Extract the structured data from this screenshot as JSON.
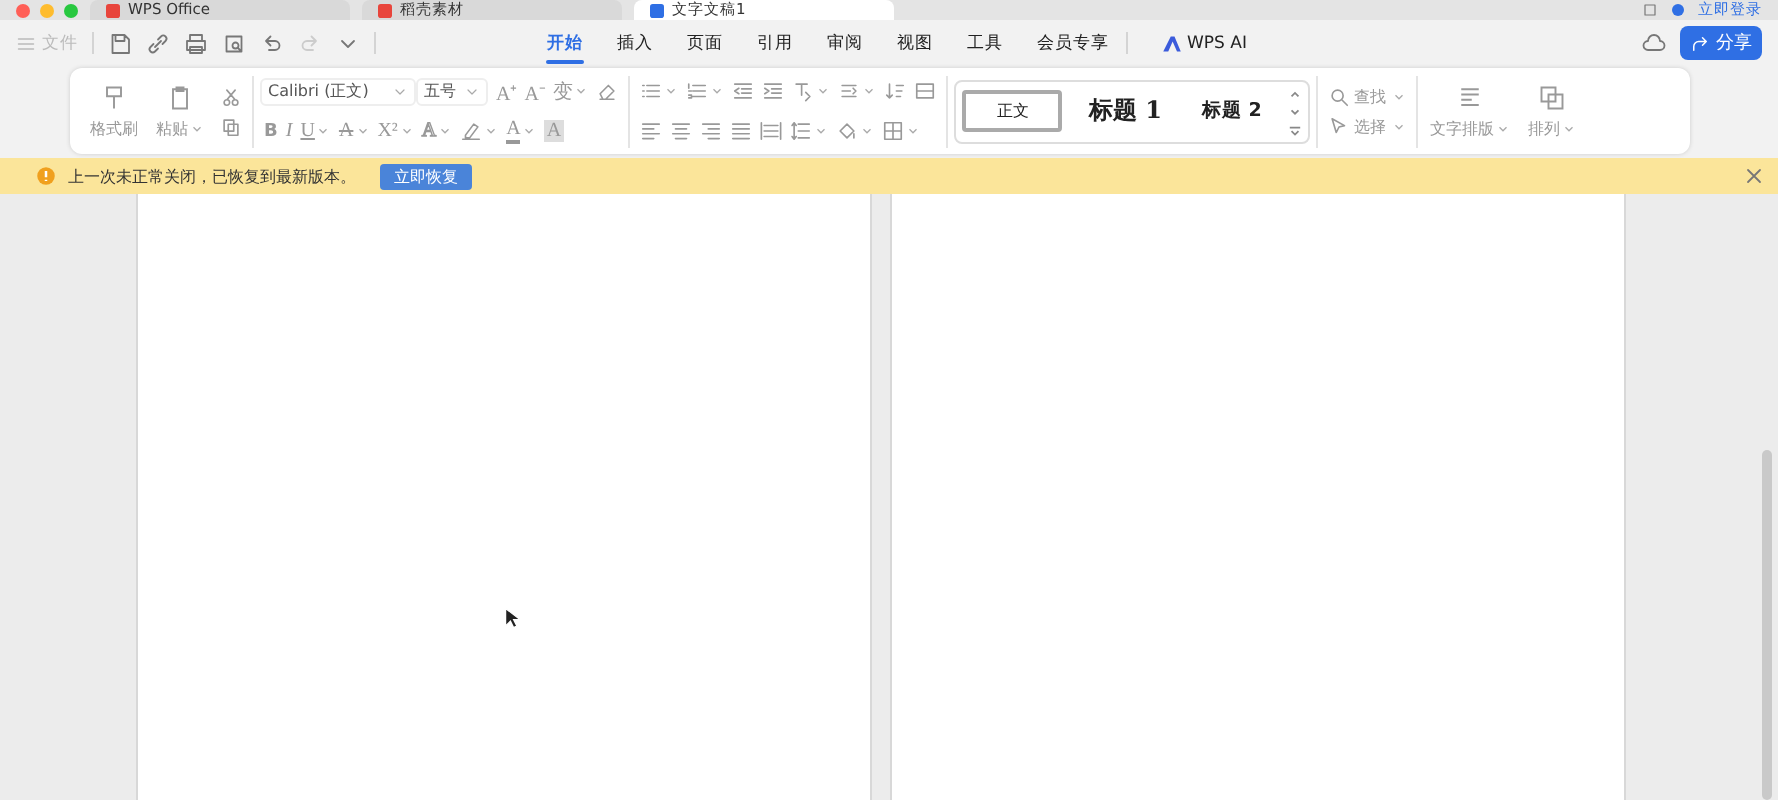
{
  "title_bar": {
    "tabs": [
      {
        "label": "WPS Office",
        "selected": false
      },
      {
        "label": "稻壳素材",
        "selected": false
      },
      {
        "label": "文字文稿1",
        "selected": true
      }
    ],
    "login": "立即登录"
  },
  "menu_bar": {
    "file": {
      "label": "文件",
      "disabled": true
    },
    "quick_tools": [
      {
        "disabled": false
      },
      {
        "disabled": false
      },
      {
        "disabled": false
      },
      {
        "disabled": false
      },
      {
        "disabled": false
      },
      {
        "disabled": true
      },
      {
        "disabled": false
      }
    ],
    "tabs": [
      {
        "label": "开始",
        "selected": true
      },
      {
        "label": "插入",
        "selected": false
      },
      {
        "label": "页面",
        "selected": false
      },
      {
        "label": "引用",
        "selected": false
      },
      {
        "label": "审阅",
        "selected": false
      },
      {
        "label": "视图",
        "selected": false
      },
      {
        "label": "工具",
        "selected": false
      },
      {
        "label": "会员专享",
        "selected": false
      }
    ],
    "ai_label": "WPS AI",
    "share": "分享"
  },
  "ribbon": {
    "clipboard": [
      "格式刷",
      "粘贴"
    ],
    "font_name": "Calibri (正文)",
    "font_size": "五号",
    "font_row1_glyphs": [
      "A⁺",
      "A⁻",
      "变"
    ],
    "font_row2_glyphs": [
      "B",
      "I",
      "U",
      "A",
      "X²",
      "A",
      "A",
      "A"
    ],
    "styles": [
      {
        "label": "正文",
        "selected": true
      },
      {
        "label": "标题 1",
        "selected": false
      },
      {
        "label": "标题 2",
        "selected": false
      }
    ],
    "find": [
      "查找",
      "选择"
    ],
    "layout": [
      "文字排版",
      "排列"
    ]
  },
  "notice": {
    "message": "上一次未正常关闭，已恢复到最新版本。",
    "action": "立即恢复"
  }
}
